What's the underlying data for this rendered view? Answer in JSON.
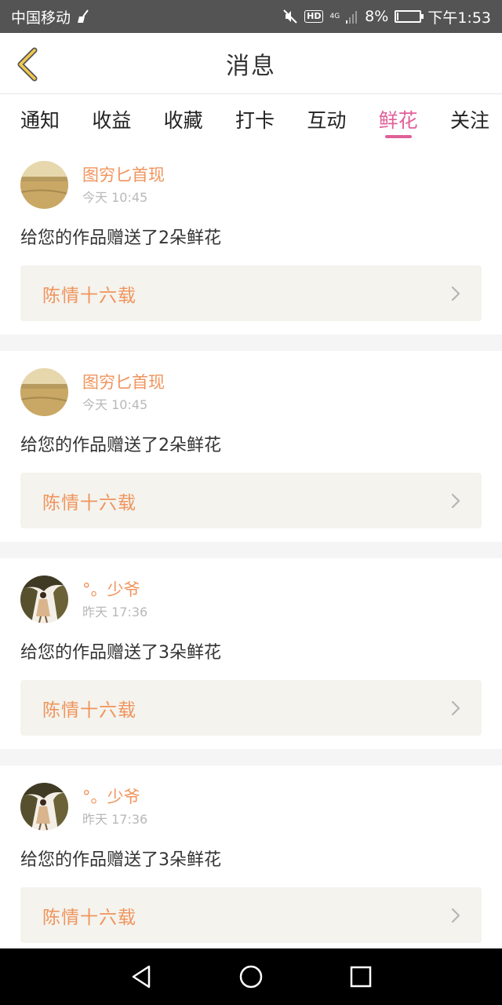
{
  "status_bar": {
    "carrier": "中国移动",
    "hd": "HD",
    "network": "4G",
    "battery_percent": "8%",
    "battery_level": 0.08,
    "time": "下午1:53"
  },
  "header": {
    "title": "消息"
  },
  "tabs": [
    {
      "label": "通知"
    },
    {
      "label": "收益"
    },
    {
      "label": "收藏"
    },
    {
      "label": "打卡"
    },
    {
      "label": "互动"
    },
    {
      "label": "鲜花",
      "active": true
    },
    {
      "label": "关注"
    }
  ],
  "colors": {
    "accent_pink": "#e0609a",
    "name_orange": "#f0945c",
    "box_bg": "#f4f3ee"
  },
  "feed": [
    {
      "user": "图穷匕首现",
      "time": "今天 10:45",
      "message": "给您的作品赠送了2朵鲜花",
      "work": "陈情十六载",
      "avatar": "landscape"
    },
    {
      "user": "图穷匕首现",
      "time": "今天 10:45",
      "message": "给您的作品赠送了2朵鲜花",
      "work": "陈情十六载",
      "avatar": "landscape"
    },
    {
      "user": "°。少爷",
      "time": "昨天 17:36",
      "message": "给您的作品赠送了3朵鲜花",
      "work": "陈情十六载",
      "avatar": "person"
    },
    {
      "user": "°。少爷",
      "time": "昨天 17:36",
      "message": "给您的作品赠送了3朵鲜花",
      "work": "陈情十六载",
      "avatar": "person"
    }
  ]
}
